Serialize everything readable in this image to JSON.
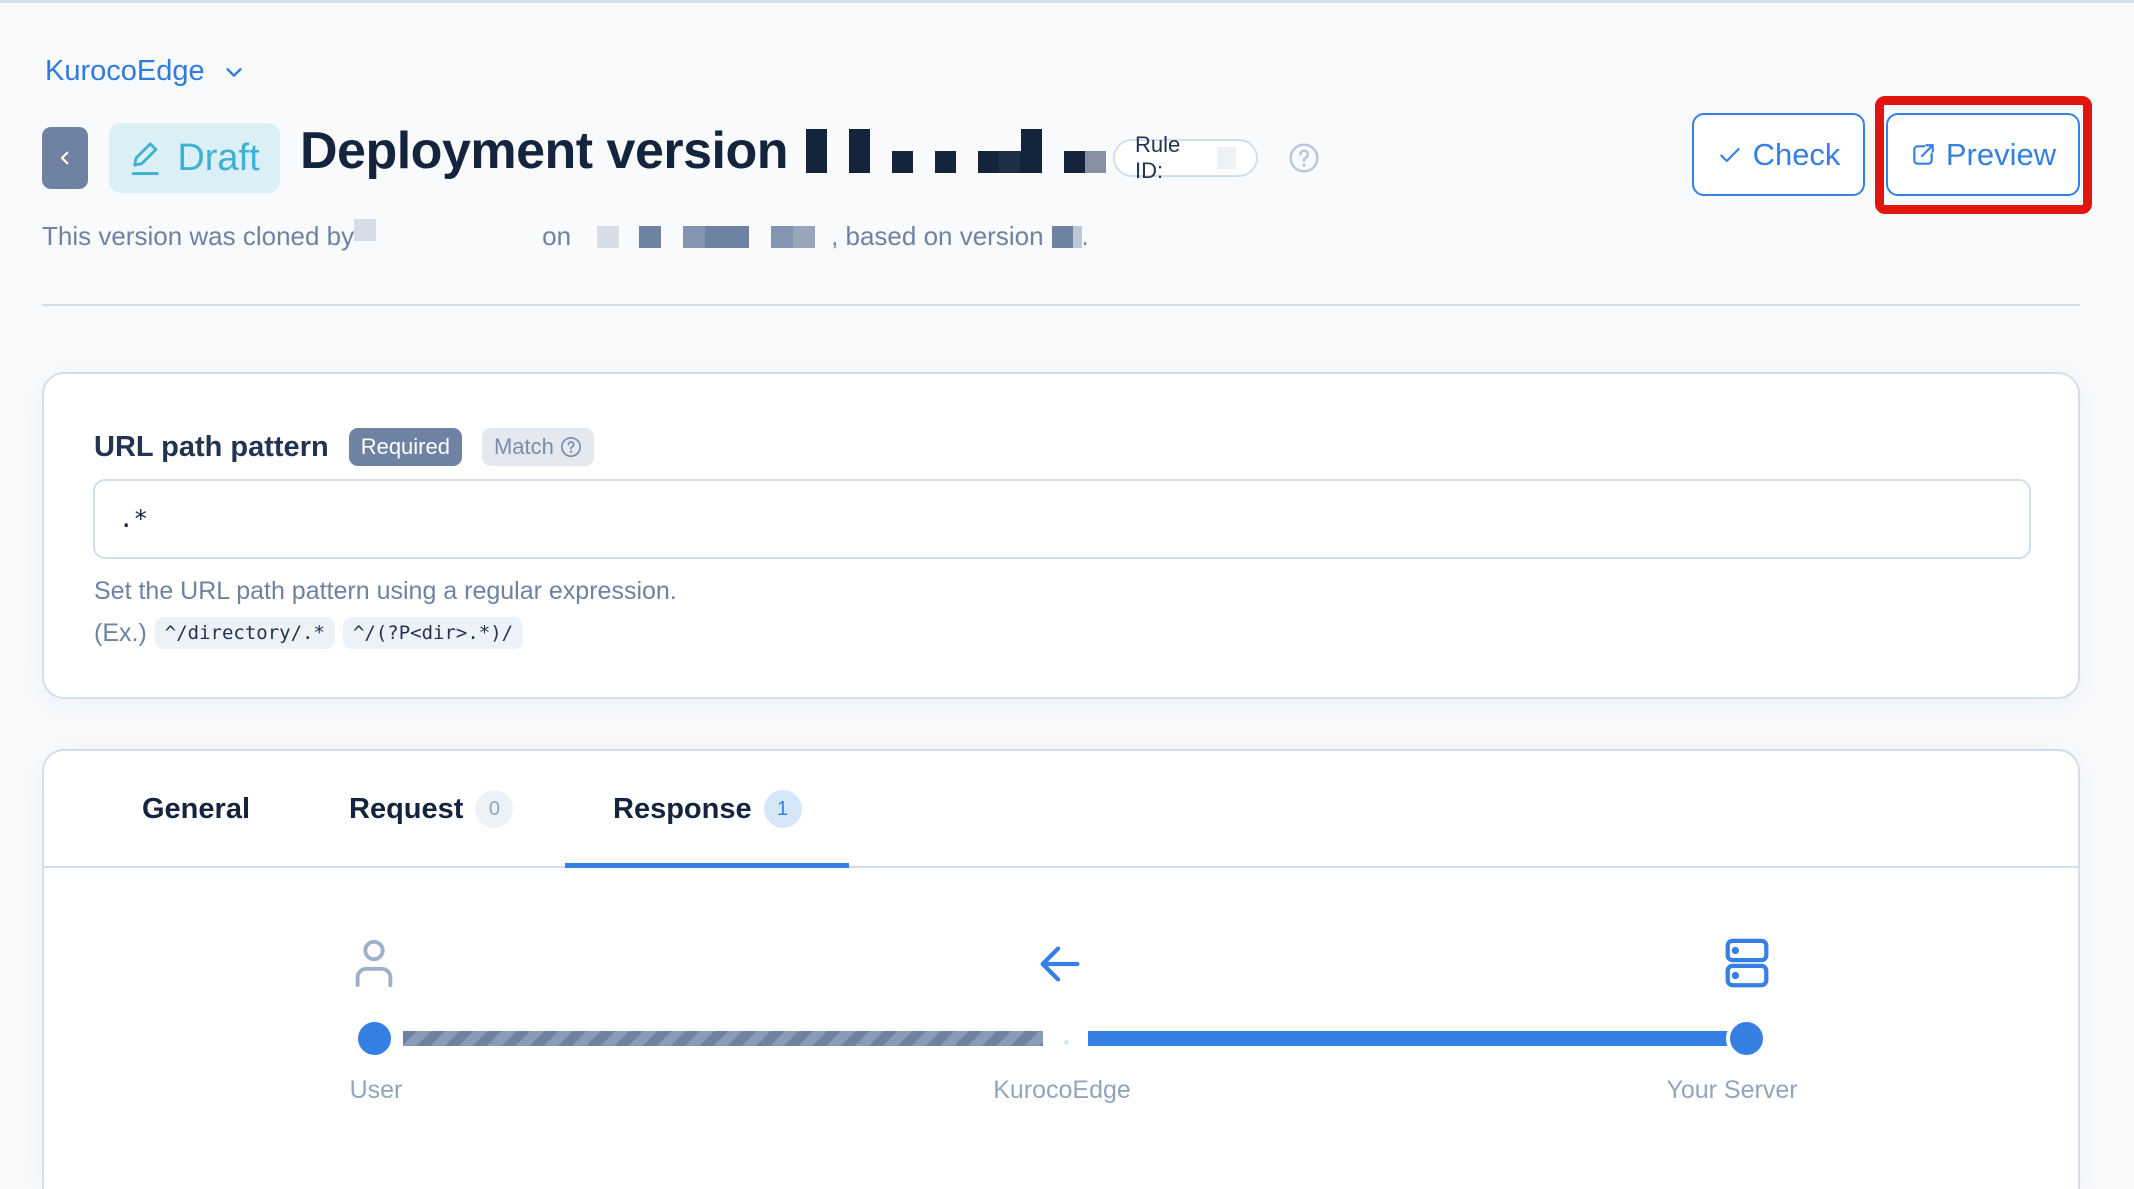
{
  "header": {
    "project_name": "KurocoEdge",
    "status_badge": "Draft",
    "title": "Deployment version",
    "rule_id_label": "Rule ID:",
    "subtitle": {
      "prefix": "This version was cloned by",
      "on": "on",
      "based_on": ", based on version",
      "suffix": "."
    },
    "buttons": {
      "check": "Check",
      "preview": "Preview"
    }
  },
  "url_pattern": {
    "label": "URL path pattern",
    "required_tag": "Required",
    "match_tag": "Match",
    "value": ".*",
    "help_text": "Set the URL path pattern using a regular expression.",
    "examples_prefix": "(Ex.)",
    "examples": [
      "^/directory/.*",
      "^/(?P<dir>.*)/"
    ]
  },
  "tabs": [
    {
      "label": "General",
      "count": null,
      "active": false
    },
    {
      "label": "Request",
      "count": "0",
      "active": false
    },
    {
      "label": "Response",
      "count": "1",
      "active": true
    }
  ],
  "flow": {
    "direction": "response",
    "nodes": [
      {
        "label": "User",
        "icon": "user-icon"
      },
      {
        "label": "KurocoEdge",
        "icon": "arrow-left-icon"
      },
      {
        "label": "Your Server",
        "icon": "server-icon"
      }
    ]
  },
  "colors": {
    "accent": "#3580e2",
    "draft": "#3fb2d4",
    "muted": "#6f82a1",
    "highlight": "#e0150d"
  }
}
